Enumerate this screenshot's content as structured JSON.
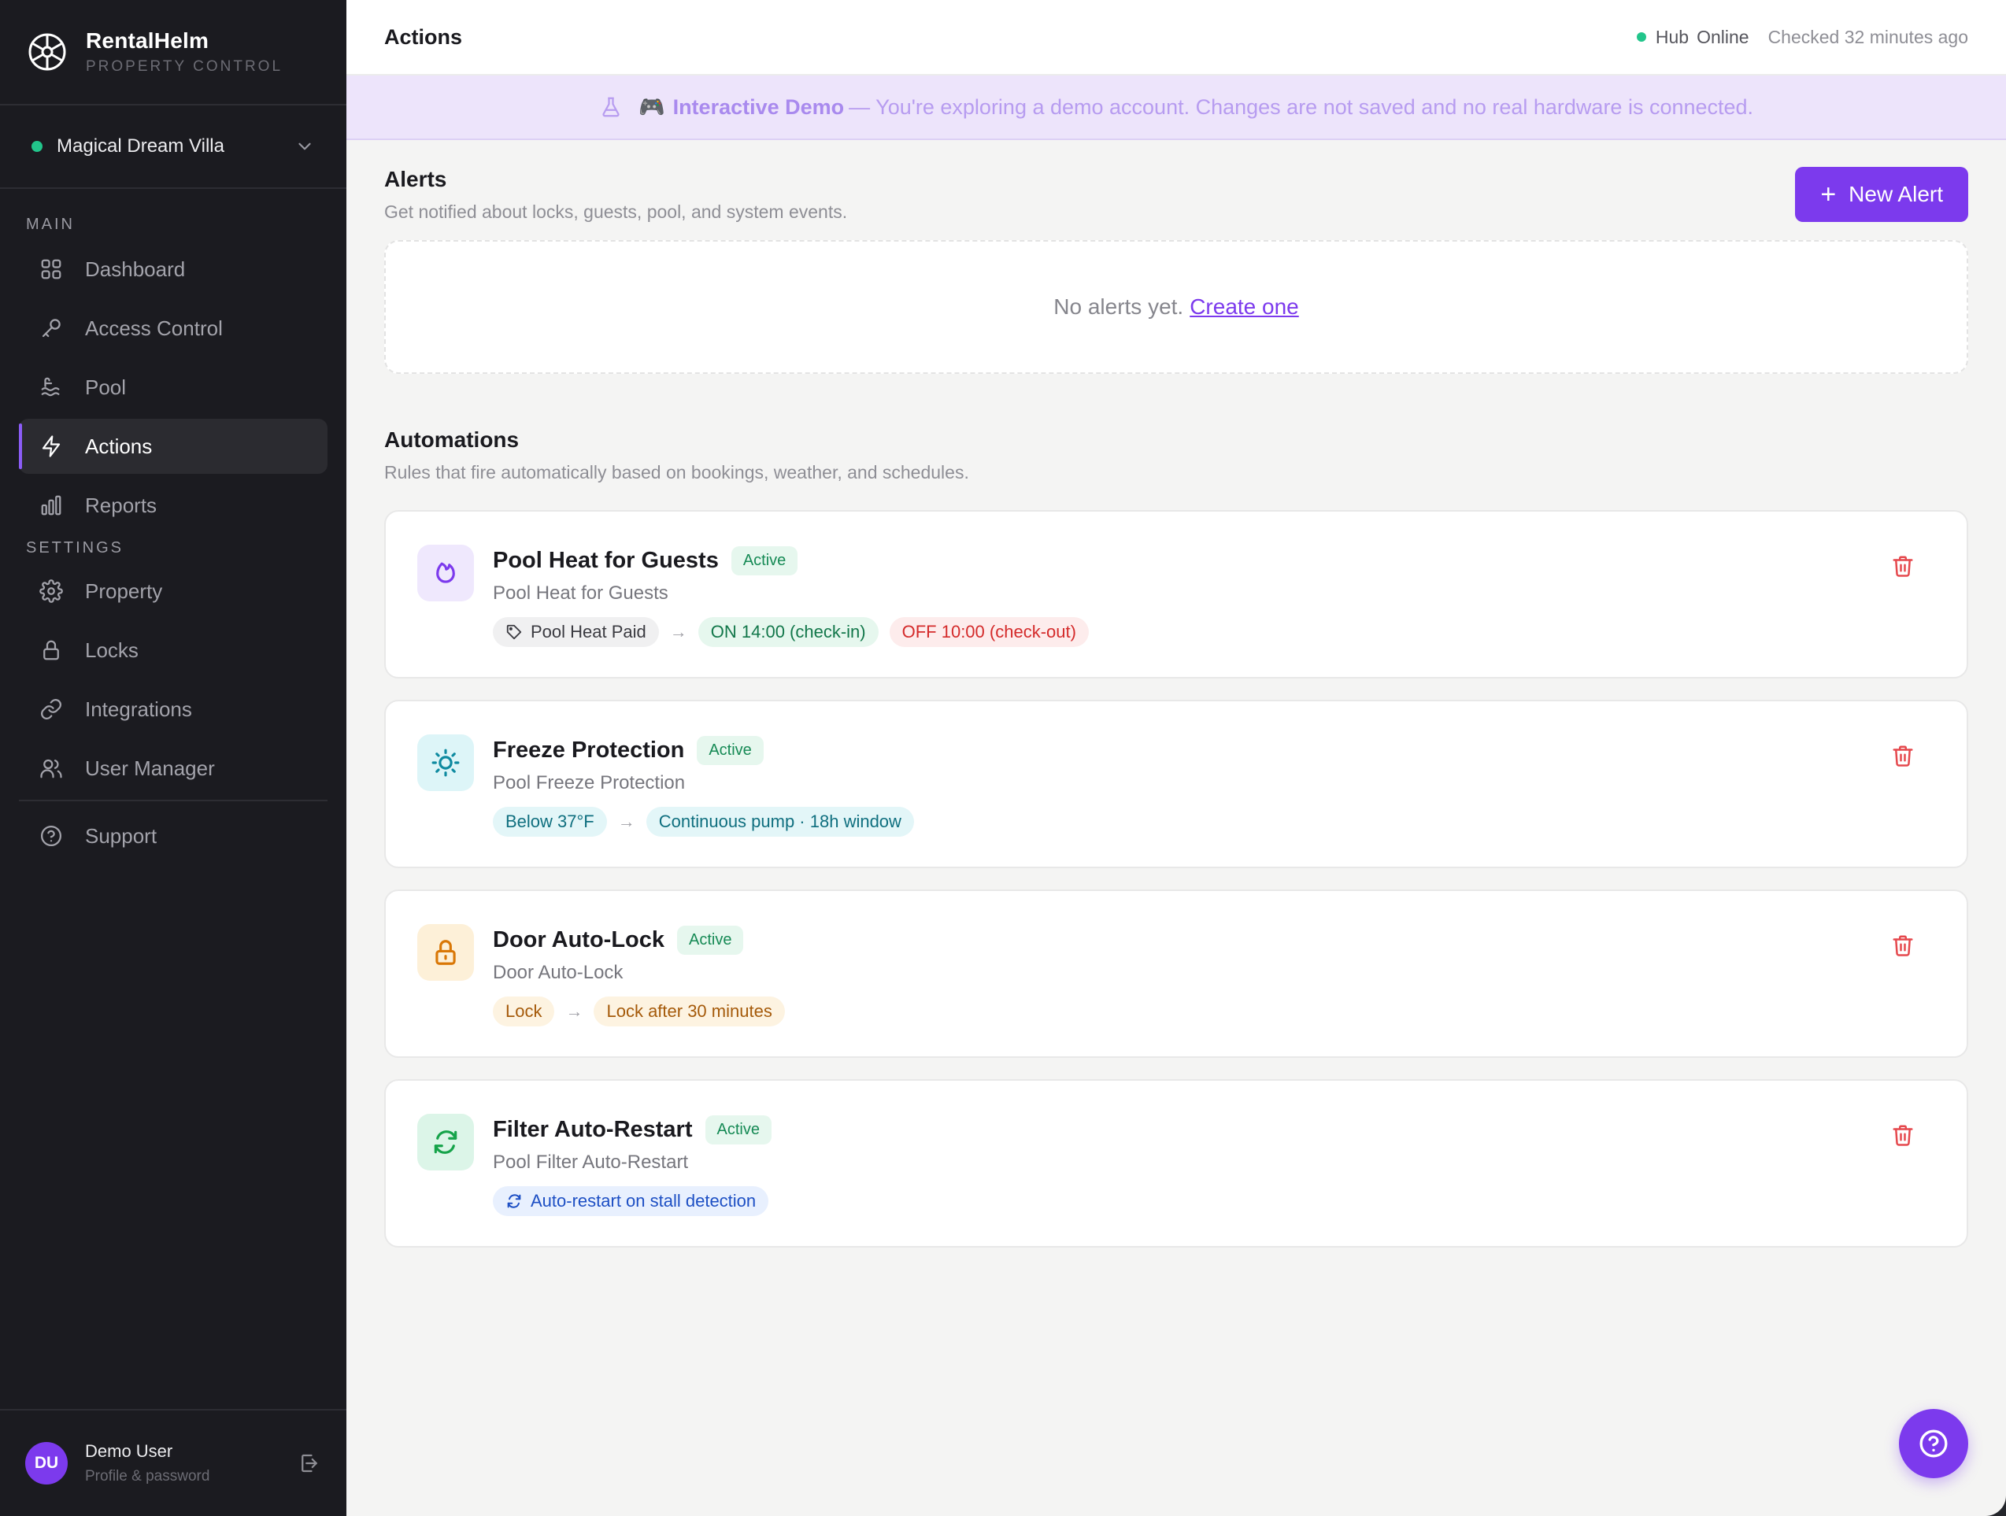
{
  "brand": {
    "name": "RentalHelm",
    "subtitle": "PROPERTY CONTROL"
  },
  "property_selector": {
    "name": "Magical Dream Villa",
    "status_color": "#22c58b"
  },
  "sidebar": {
    "main_label": "MAIN",
    "settings_label": "SETTINGS",
    "main_items": [
      {
        "label": "Dashboard",
        "icon": "grid-icon"
      },
      {
        "label": "Access Control",
        "icon": "key-icon"
      },
      {
        "label": "Pool",
        "icon": "waves-icon"
      },
      {
        "label": "Actions",
        "icon": "lightning-icon",
        "active": true
      },
      {
        "label": "Reports",
        "icon": "bar-chart-icon"
      }
    ],
    "settings_items": [
      {
        "label": "Property",
        "icon": "gear-icon"
      },
      {
        "label": "Locks",
        "icon": "lock-icon"
      },
      {
        "label": "Integrations",
        "icon": "link-icon"
      },
      {
        "label": "User Manager",
        "icon": "users-icon"
      }
    ],
    "support_item": {
      "label": "Support",
      "icon": "help-circle-icon"
    }
  },
  "user": {
    "initials": "DU",
    "name": "Demo User",
    "subtitle": "Profile & password"
  },
  "topbar": {
    "title": "Actions",
    "hub_label": "Hub",
    "hub_status": "Online",
    "checked": "Checked 32 minutes ago"
  },
  "banner": {
    "emoji": "🎮",
    "title": "Interactive Demo",
    "message": "— You're exploring a demo account. Changes are not saved and no real hardware is connected."
  },
  "alerts": {
    "title": "Alerts",
    "description": "Get notified about locks, guests, pool, and system events.",
    "new_button": "New Alert",
    "empty_text": "No alerts yet.",
    "create_link": "Create one"
  },
  "automations": {
    "title": "Automations",
    "description": "Rules that fire automatically based on bookings, weather, and schedules.",
    "items": [
      {
        "title": "Pool Heat for Guests",
        "status": "Active",
        "subtitle": "Pool Heat for Guests",
        "icon": "flame-icon",
        "trigger": "Pool Heat Paid",
        "action_on": "ON 14:00 (check-in)",
        "action_off": "OFF 10:00 (check-out)"
      },
      {
        "title": "Freeze Protection",
        "status": "Active",
        "subtitle": "Pool Freeze Protection",
        "icon": "sun-icon",
        "trigger": "Below 37°F",
        "action": "Continuous pump · 18h window"
      },
      {
        "title": "Door Auto-Lock",
        "status": "Active",
        "subtitle": "Door Auto-Lock",
        "icon": "lock-icon",
        "trigger": "Lock",
        "action": "Lock after 30 minutes"
      },
      {
        "title": "Filter Auto-Restart",
        "status": "Active",
        "subtitle": "Pool Filter Auto-Restart",
        "icon": "refresh-icon",
        "action": "Auto-restart on stall detection"
      }
    ]
  },
  "colors": {
    "accent": "#7c3aed",
    "sidebar_bg": "#1b1b20",
    "active_green": "#168a55",
    "danger": "#e5484d"
  }
}
